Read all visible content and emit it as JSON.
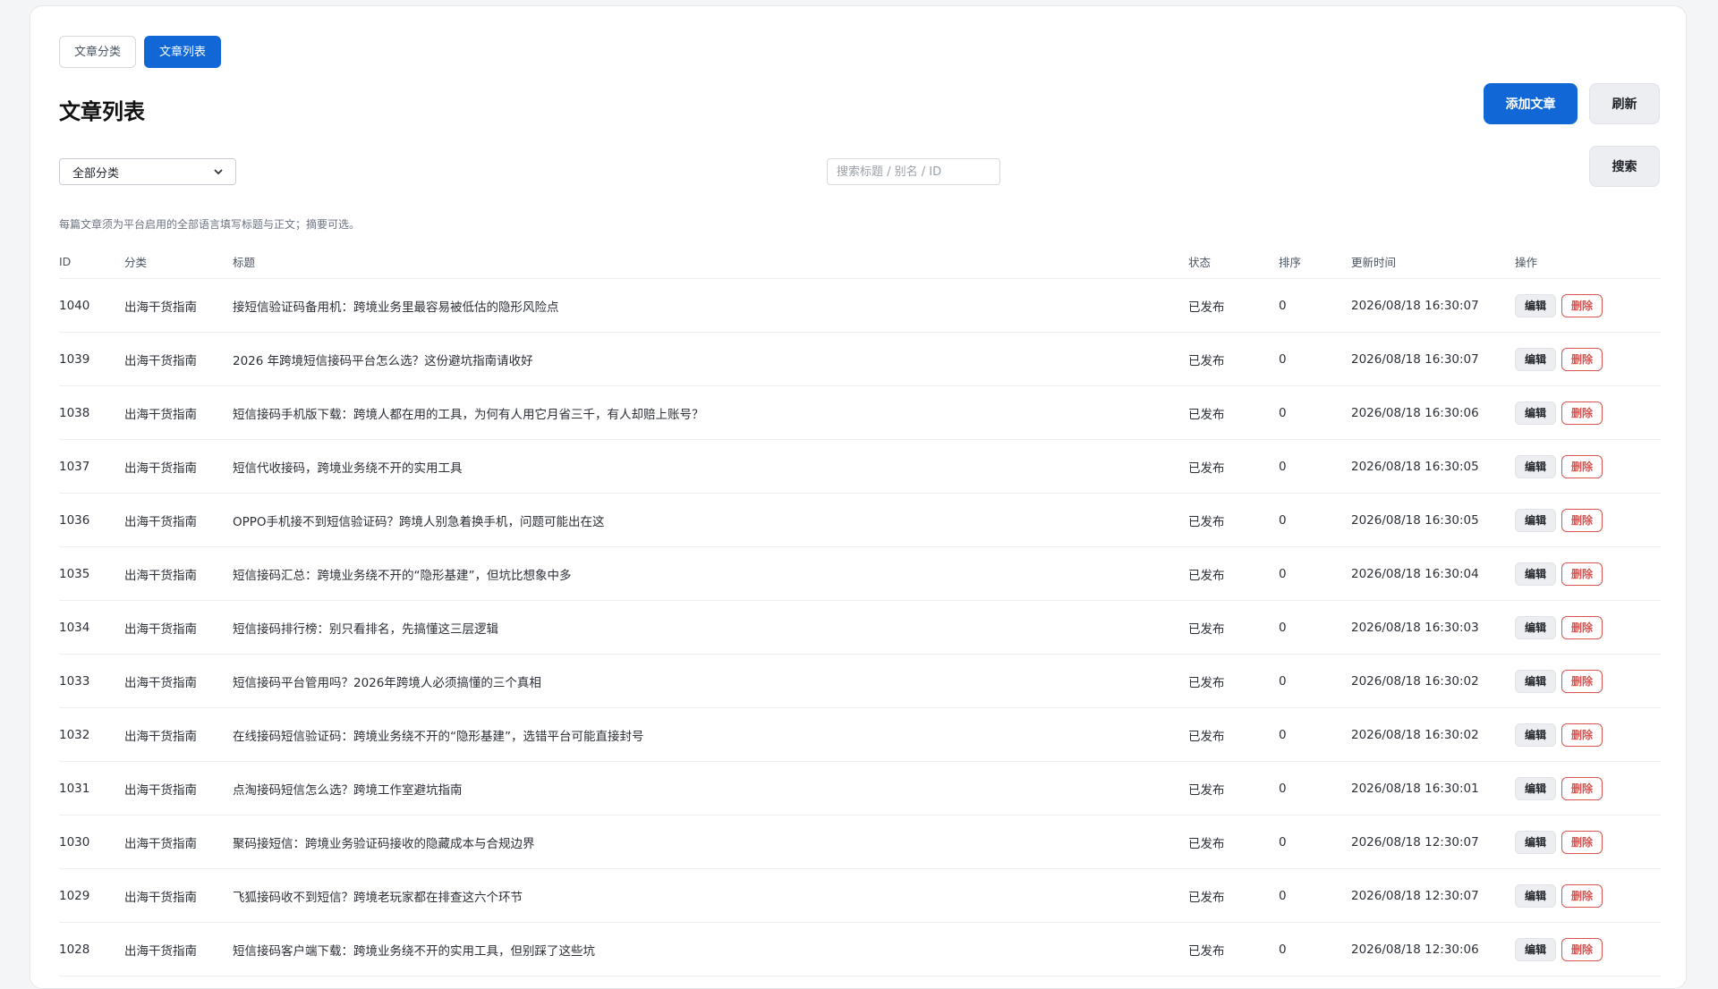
{
  "tabs": [
    {
      "label": "文章分类",
      "active": false
    },
    {
      "label": "文章列表",
      "active": true
    }
  ],
  "page_title": "文章列表",
  "toolbar": {
    "add_label": "添加文章",
    "refresh_label": "刷新",
    "search_label": "搜索"
  },
  "filters": {
    "category_selected": "全部分类",
    "search_placeholder": "搜索标题 / 别名 / ID"
  },
  "note": "每篇文章须为平台启用的全部语言填写标题与正文；摘要可选。",
  "table": {
    "columns": [
      "ID",
      "分类",
      "标题",
      "状态",
      "排序",
      "更新时间",
      "操作"
    ],
    "edit_label": "编辑",
    "delete_label": "删除",
    "rows": [
      {
        "id": "1040",
        "category": "出海干货指南",
        "title": "接短信验证码备用机：跨境业务里最容易被低估的隐形风险点",
        "status": "已发布",
        "order": "0",
        "updated": "2026/08/18 16:30:07"
      },
      {
        "id": "1039",
        "category": "出海干货指南",
        "title": "2026 年跨境短信接码平台怎么选？这份避坑指南请收好",
        "status": "已发布",
        "order": "0",
        "updated": "2026/08/18 16:30:07"
      },
      {
        "id": "1038",
        "category": "出海干货指南",
        "title": "短信接码手机版下载：跨境人都在用的工具，为何有人用它月省三千，有人却赔上账号？",
        "status": "已发布",
        "order": "0",
        "updated": "2026/08/18 16:30:06"
      },
      {
        "id": "1037",
        "category": "出海干货指南",
        "title": "短信代收接码，跨境业务绕不开的实用工具",
        "status": "已发布",
        "order": "0",
        "updated": "2026/08/18 16:30:05"
      },
      {
        "id": "1036",
        "category": "出海干货指南",
        "title": "OPPO手机接不到短信验证码？跨境人别急着换手机，问题可能出在这",
        "status": "已发布",
        "order": "0",
        "updated": "2026/08/18 16:30:05"
      },
      {
        "id": "1035",
        "category": "出海干货指南",
        "title": "短信接码汇总：跨境业务绕不开的“隐形基建”，但坑比想象中多",
        "status": "已发布",
        "order": "0",
        "updated": "2026/08/18 16:30:04"
      },
      {
        "id": "1034",
        "category": "出海干货指南",
        "title": "短信接码排行榜：别只看排名，先搞懂这三层逻辑",
        "status": "已发布",
        "order": "0",
        "updated": "2026/08/18 16:30:03"
      },
      {
        "id": "1033",
        "category": "出海干货指南",
        "title": "短信接码平台管用吗？2026年跨境人必须搞懂的三个真相",
        "status": "已发布",
        "order": "0",
        "updated": "2026/08/18 16:30:02"
      },
      {
        "id": "1032",
        "category": "出海干货指南",
        "title": "在线接码短信验证码：跨境业务绕不开的“隐形基建”，选错平台可能直接封号",
        "status": "已发布",
        "order": "0",
        "updated": "2026/08/18 16:30:02"
      },
      {
        "id": "1031",
        "category": "出海干货指南",
        "title": "点淘接码短信怎么选？跨境工作室避坑指南",
        "status": "已发布",
        "order": "0",
        "updated": "2026/08/18 16:30:01"
      },
      {
        "id": "1030",
        "category": "出海干货指南",
        "title": "聚码接短信：跨境业务验证码接收的隐藏成本与合规边界",
        "status": "已发布",
        "order": "0",
        "updated": "2026/08/18 12:30:07"
      },
      {
        "id": "1029",
        "category": "出海干货指南",
        "title": "飞狐接码收不到短信？跨境老玩家都在排查这六个环节",
        "status": "已发布",
        "order": "0",
        "updated": "2026/08/18 12:30:07"
      },
      {
        "id": "1028",
        "category": "出海干货指南",
        "title": "短信接码客户端下载：跨境业务绕不开的实用工具，但别踩了这些坑",
        "status": "已发布",
        "order": "0",
        "updated": "2026/08/18 12:30:06"
      }
    ]
  }
}
